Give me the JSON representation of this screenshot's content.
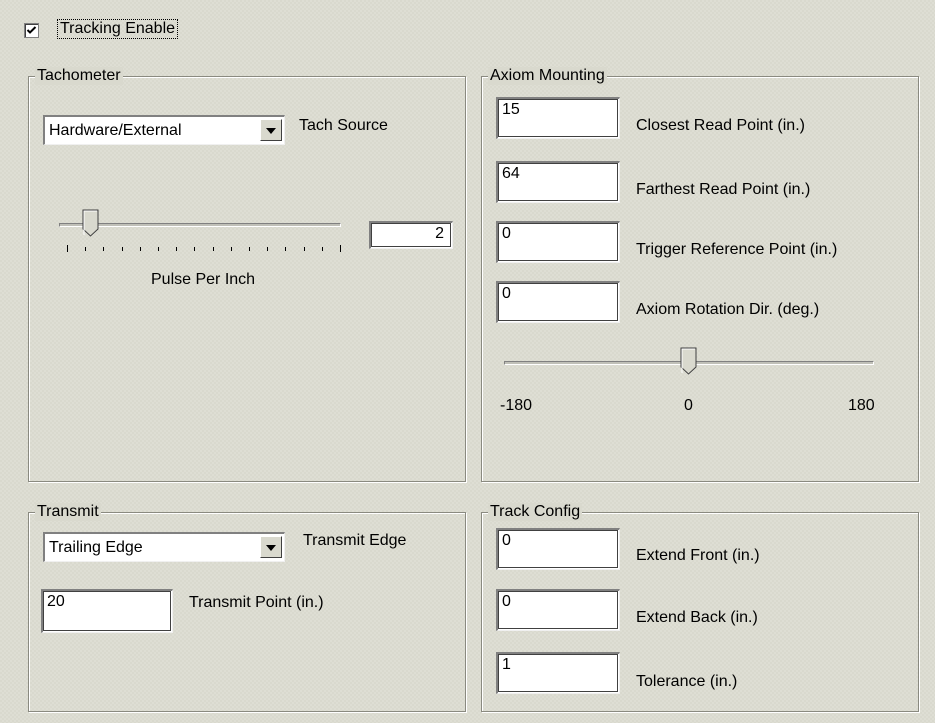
{
  "tracking": {
    "label": "Tracking Enable",
    "checked": true
  },
  "tachometer": {
    "title": "Tachometer",
    "source_value": "Hardware/External",
    "source_label": "Tach Source",
    "slider_value": 2,
    "slider_caption": "Pulse Per Inch",
    "slider_text": "2"
  },
  "axiom": {
    "title": "Axiom Mounting",
    "closest_value": "15",
    "closest_label": "Closest Read Point (in.)",
    "farthest_value": "64",
    "farthest_label": "Farthest Read Point (in.)",
    "trigger_value": "0",
    "trigger_label": "Trigger Reference Point (in.)",
    "rotation_value": "0",
    "rotation_label": "Axiom Rotation Dir. (deg.)",
    "rotation_slider": 0,
    "min_label": "-180",
    "mid_label": "0",
    "max_label": "180"
  },
  "transmit": {
    "title": "Transmit",
    "edge_value": "Trailing Edge",
    "edge_label": "Transmit Edge",
    "point_value": "20",
    "point_label": "Transmit Point (in.)"
  },
  "track_config": {
    "title": "Track Config",
    "front_value": "0",
    "front_label": "Extend Front (in.)",
    "back_value": "0",
    "back_label": "Extend Back (in.)",
    "tolerance_value": "1",
    "tolerance_label": "Tolerance (in.)"
  }
}
